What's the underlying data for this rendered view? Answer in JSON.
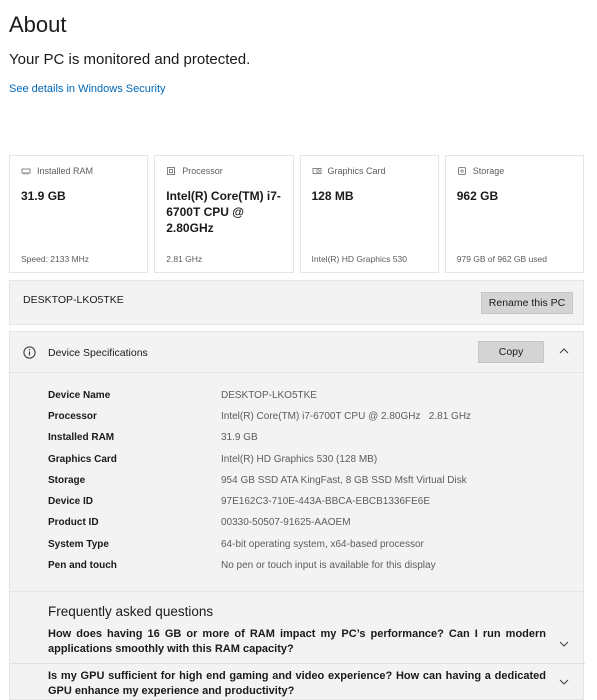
{
  "page": {
    "title": "About",
    "protection_text": "Your PC is monitored and protected.",
    "security_link": "See details in Windows Security"
  },
  "cards": [
    {
      "label": "Installed RAM",
      "value": "31.9 GB",
      "foot": "Speed: 2133 MHz",
      "icon": "ram-icon"
    },
    {
      "label": "Processor",
      "value": "Intel(R) Core(TM) i7-6700T CPU @ 2.80GHz",
      "foot": "2.81 GHz",
      "icon": "processor-icon"
    },
    {
      "label": "Graphics Card",
      "value": "128 MB",
      "foot": "Intel(R) HD Graphics 530",
      "icon": "graphics-card-icon"
    },
    {
      "label": "Storage",
      "value": "962 GB",
      "foot": "979 GB of 962 GB used",
      "icon": "storage-icon"
    }
  ],
  "rename": {
    "device_name": "DESKTOP-LKO5TKE",
    "button_label": "Rename this PC"
  },
  "specs": {
    "title": "Device Specifications",
    "copy_label": "Copy",
    "rows": [
      {
        "label": "Device Name",
        "value": "DESKTOP-LKO5TKE"
      },
      {
        "label": "Processor",
        "value": "Intel(R) Core(TM) i7-6700T CPU @ 2.80GHz   2.81 GHz"
      },
      {
        "label": "Installed RAM",
        "value": "31.9 GB"
      },
      {
        "label": "Graphics Card",
        "value": "Intel(R) HD Graphics 530 (128 MB)"
      },
      {
        "label": "Storage",
        "value": "954 GB SSD ATA KingFast, 8 GB SSD Msft Virtual Disk"
      },
      {
        "label": "Device ID",
        "value": "97E162C3-710E-443A-BBCA-EBCB1336FE6E"
      },
      {
        "label": "Product ID",
        "value": "00330-50507-91625-AAOEM"
      },
      {
        "label": "System Type",
        "value": "64-bit operating system, x64-based processor"
      },
      {
        "label": "Pen and touch",
        "value": "No pen or touch input is available for this display"
      }
    ]
  },
  "faq": {
    "title": "Frequently asked questions",
    "questions": [
      "How does having 16 GB or more of RAM impact my PC’s performance? Can I run modern applications smoothly with this RAM capacity?",
      "Is my GPU sufficient for high end gaming and video experience? How can having a dedicated GPU enhance my experience and productivity?"
    ]
  }
}
